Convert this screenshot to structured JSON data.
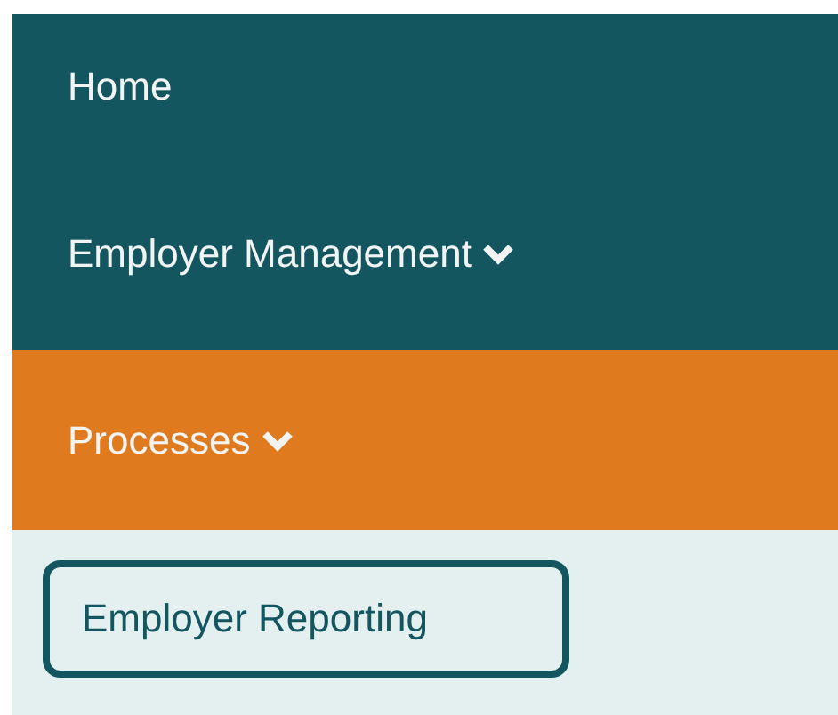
{
  "menu": [
    {
      "label": "Home",
      "dropdown": false,
      "selected": false
    },
    {
      "label": "Employer Management",
      "dropdown": true,
      "selected": false
    },
    {
      "label": "Processes",
      "dropdown": true,
      "selected": true,
      "children": [
        {
          "label": "Employer Reporting",
          "selected": true
        }
      ]
    }
  ]
}
